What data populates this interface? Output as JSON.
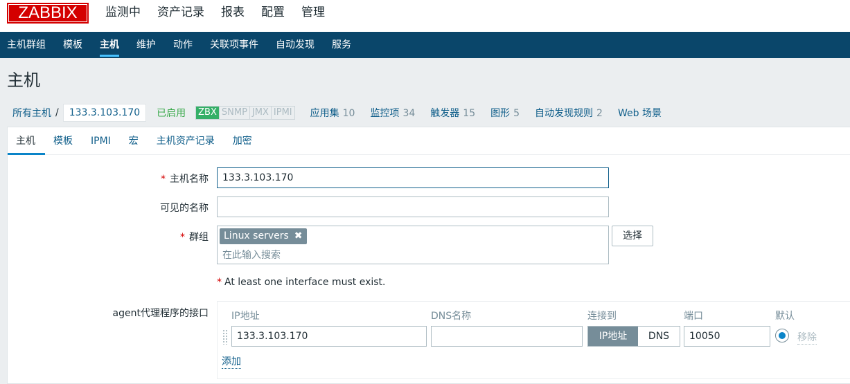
{
  "logo": {
    "text": "ZABBIX"
  },
  "top_menu": [
    {
      "label": "监测中"
    },
    {
      "label": "资产记录"
    },
    {
      "label": "报表"
    },
    {
      "label": "配置",
      "active": true
    },
    {
      "label": "管理"
    }
  ],
  "sub_menu": [
    {
      "label": "主机群组"
    },
    {
      "label": "模板"
    },
    {
      "label": "主机",
      "active": true
    },
    {
      "label": "维护"
    },
    {
      "label": "动作"
    },
    {
      "label": "关联项事件"
    },
    {
      "label": "自动发现"
    },
    {
      "label": "服务"
    }
  ],
  "page_title": "主机",
  "breadcrumb": {
    "all_hosts": "所有主机",
    "separator": "/",
    "current": "133.3.103.170",
    "status": "已启用",
    "availability": [
      "ZBX",
      "SNMP",
      "JMX",
      "IPMI"
    ],
    "stats": [
      {
        "label": "应用集",
        "count": "10"
      },
      {
        "label": "监控项",
        "count": "34"
      },
      {
        "label": "触发器",
        "count": "15"
      },
      {
        "label": "图形",
        "count": "5"
      },
      {
        "label": "自动发现规则",
        "count": "2"
      },
      {
        "label": "Web 场景",
        "count": ""
      }
    ]
  },
  "tabs": [
    "主机",
    "模板",
    "IPMI",
    "宏",
    "主机资产记录",
    "加密"
  ],
  "form": {
    "required_mark": "*",
    "host_name_label": "主机名称",
    "host_name_value": "133.3.103.170",
    "visible_name_label": "可见的名称",
    "visible_name_value": "",
    "groups_label": "群组",
    "group_chip": "Linux servers",
    "group_chip_remove": "✖",
    "groups_placeholder": "在此输入搜索",
    "select_button": "选择",
    "interface_warning": "At least one interface must exist.",
    "agent_interface_label": "agent代理程序的接口"
  },
  "interfaces": {
    "headers": {
      "ip": "IP地址",
      "dns": "DNS名称",
      "connect_to": "连接到",
      "port": "端口",
      "default": "默认"
    },
    "row": {
      "ip": "133.3.103.170",
      "dns": "",
      "connect_ip": "IP地址",
      "connect_dns": "DNS",
      "port": "10050",
      "remove": "移除"
    },
    "add": "添加"
  }
}
